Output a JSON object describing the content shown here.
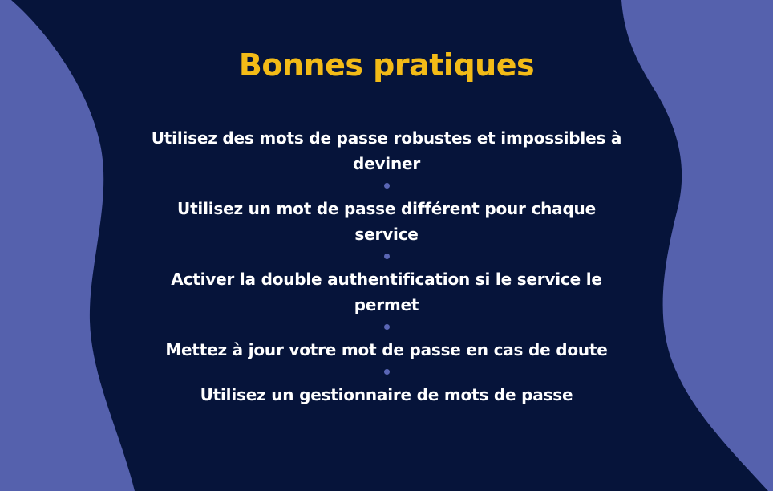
{
  "colors": {
    "background": "#06143a",
    "blob": "#5561ad",
    "title": "#f3bb17",
    "text": "#ffffff",
    "dot": "#5a66b5"
  },
  "title": "Bonnes pratiques",
  "items": [
    {
      "label": "Utilisez des mots de passe robustes et impossibles à deviner"
    },
    {
      "label": "Utilisez un mot de passe différent pour chaque service"
    },
    {
      "label": "Activer la double authentification si le service le permet"
    },
    {
      "label": "Mettez à jour votre mot de passe en cas de doute"
    },
    {
      "label": "Utilisez un gestionnaire de mots de passe"
    }
  ]
}
